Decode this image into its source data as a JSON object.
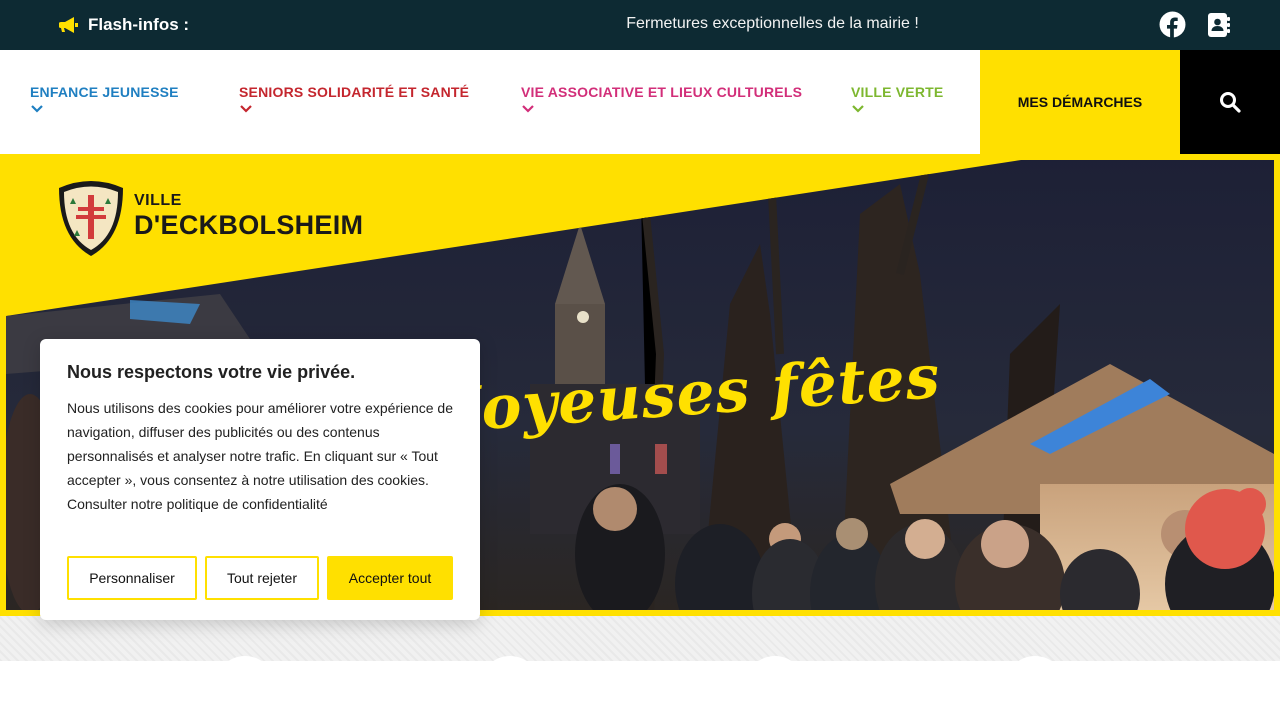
{
  "flash": {
    "label": "Flash-infos :",
    "message": "Fermetures exceptionnelles de la mairie !",
    "megaphone_icon": "megaphone-icon",
    "social_icons": [
      "facebook-icon",
      "contact-book-icon"
    ]
  },
  "nav": {
    "items": [
      {
        "label": "ENFANCE JEUNESSE",
        "color": "#1f7fc1"
      },
      {
        "label": "SENIORS SOLIDARITÉ ET SANTÉ",
        "color": "#c4262e"
      },
      {
        "label": "VIE ASSOCIATIVE ET LIEUX CULTURELS",
        "color": "#d22e79"
      },
      {
        "label": "VILLE VERTE",
        "color": "#7db72f"
      }
    ],
    "demarches": "MES DÉMARCHES",
    "search_icon": "search-icon"
  },
  "logo": {
    "ville": "VILLE",
    "name": "D'ECKBOLSHEIM"
  },
  "hero": {
    "greeting": "Joyeuses fêtes"
  },
  "cookie": {
    "title": "Nous respectons votre vie privée.",
    "text": "Nous utilisons des cookies pour améliorer votre expérience de navigation, diffuser des publicités ou des contenus personnalisés et analyser notre trafic. En cliquant sur « Tout accepter », vous consentez à notre utilisation des cookies. Consulter notre politique de confidentialité",
    "buttons": {
      "customize": "Personnaliser",
      "reject": "Tout rejeter",
      "accept": "Accepter tout"
    }
  },
  "colors": {
    "accent_yellow": "#ffe000",
    "flashbar": "#0d2a33"
  }
}
